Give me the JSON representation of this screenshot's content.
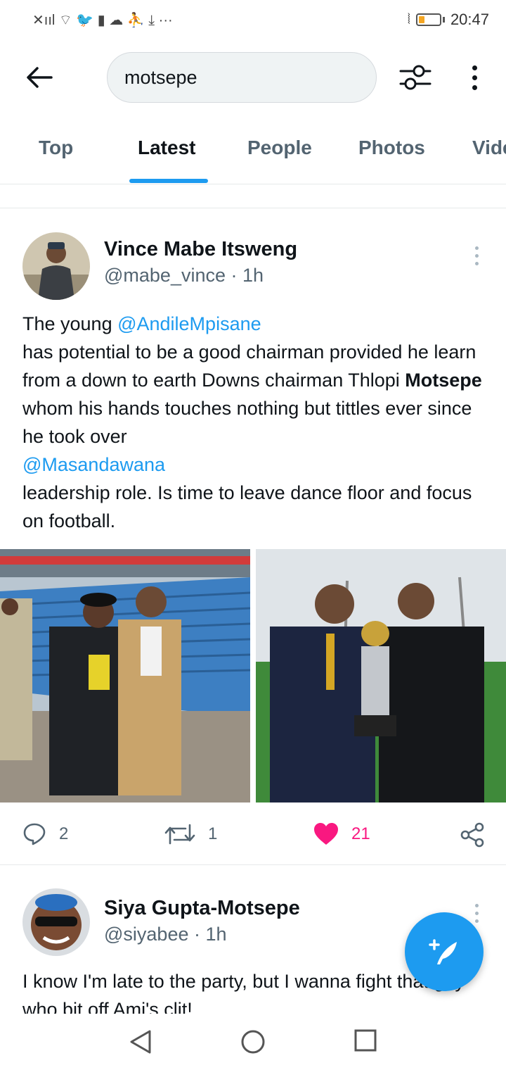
{
  "status_bar": {
    "time": "20:47",
    "left_glyphs": "✕ııl ⌔ 🐦 ▮ ☁ ⛹ ⤓ ···"
  },
  "search": {
    "query": "motsepe"
  },
  "tabs": [
    {
      "label": "Top"
    },
    {
      "label": "Latest",
      "active": true
    },
    {
      "label": "People"
    },
    {
      "label": "Photos"
    },
    {
      "label": "Vide"
    }
  ],
  "tweets": [
    {
      "name": "Vince Mabe Itsweng",
      "handle": "@mabe_vince",
      "separator": "·",
      "time": "1h",
      "text": {
        "p1": "The young ",
        "mention1": "@AndileMpisane",
        "p2": "has potential to be a good chairman provided he learn from a down to earth Downs chairman Thlopi ",
        "bold": "Motsepe",
        "p3": " whom his hands touches nothing but tittles ever since he took over",
        "mention2": "@Masandawana",
        "p4": " leadership role. Is time to leave dance floor and focus on football."
      },
      "replies": "2",
      "retweets": "1",
      "likes": "21"
    },
    {
      "name": "Siya Gupta-Motsepe",
      "handle": "@siyabee",
      "separator": "·",
      "time": "1h",
      "text": "I know I'm late to the party, but I wanna fight that guy who bit off Ami's clit!"
    }
  ],
  "colors": {
    "accent": "#1d9bf0",
    "like": "#f91880",
    "muted": "#536471"
  }
}
